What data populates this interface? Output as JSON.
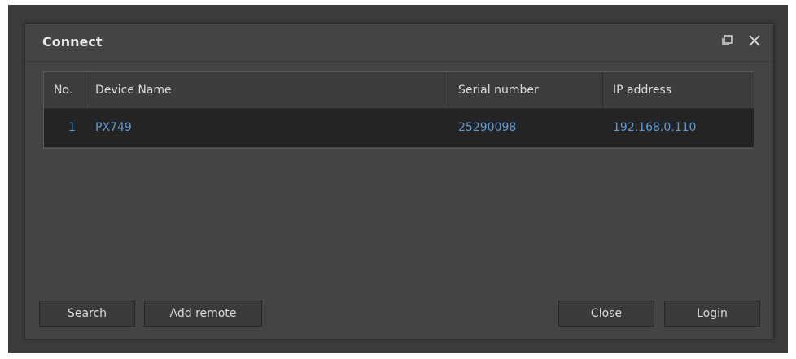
{
  "dialog": {
    "title": "Connect"
  },
  "table": {
    "columns": [
      "No.",
      "Device Name",
      "Serial number",
      "IP address"
    ],
    "rows": [
      {
        "no": "1",
        "device_name": "PX749",
        "serial": "25290098",
        "ip": "192.168.0.110"
      }
    ]
  },
  "buttons": {
    "search": "Search",
    "add_remote": "Add remote",
    "close": "Close",
    "login": "Login"
  },
  "icons": {
    "restore": "restore-window-icon",
    "close": "close-icon"
  },
  "colors": {
    "accent_link": "#5d9bd6",
    "selected_row": "#242424",
    "dialog_bg": "#444444"
  }
}
